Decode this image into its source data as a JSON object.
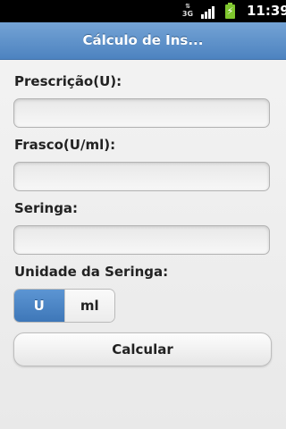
{
  "status_bar": {
    "network": "3G",
    "time": "11:39",
    "icons": [
      "network-3g-icon",
      "signal-icon",
      "battery-charging-icon"
    ],
    "battery_color": "#7fc62e"
  },
  "header": {
    "title": "Cálculo de Ins...",
    "color": "#5a8fcb"
  },
  "form": {
    "prescricao_label": "Prescrição(U):",
    "prescricao_value": "",
    "frasco_label": "Frasco(U/ml):",
    "frasco_value": "",
    "seringa_label": "Seringa:",
    "seringa_value": "",
    "unidade_label": "Unidade da Seringa:",
    "unit_options": [
      "U",
      "ml"
    ],
    "unit_selected": "U",
    "calc_button": "Calcular"
  }
}
